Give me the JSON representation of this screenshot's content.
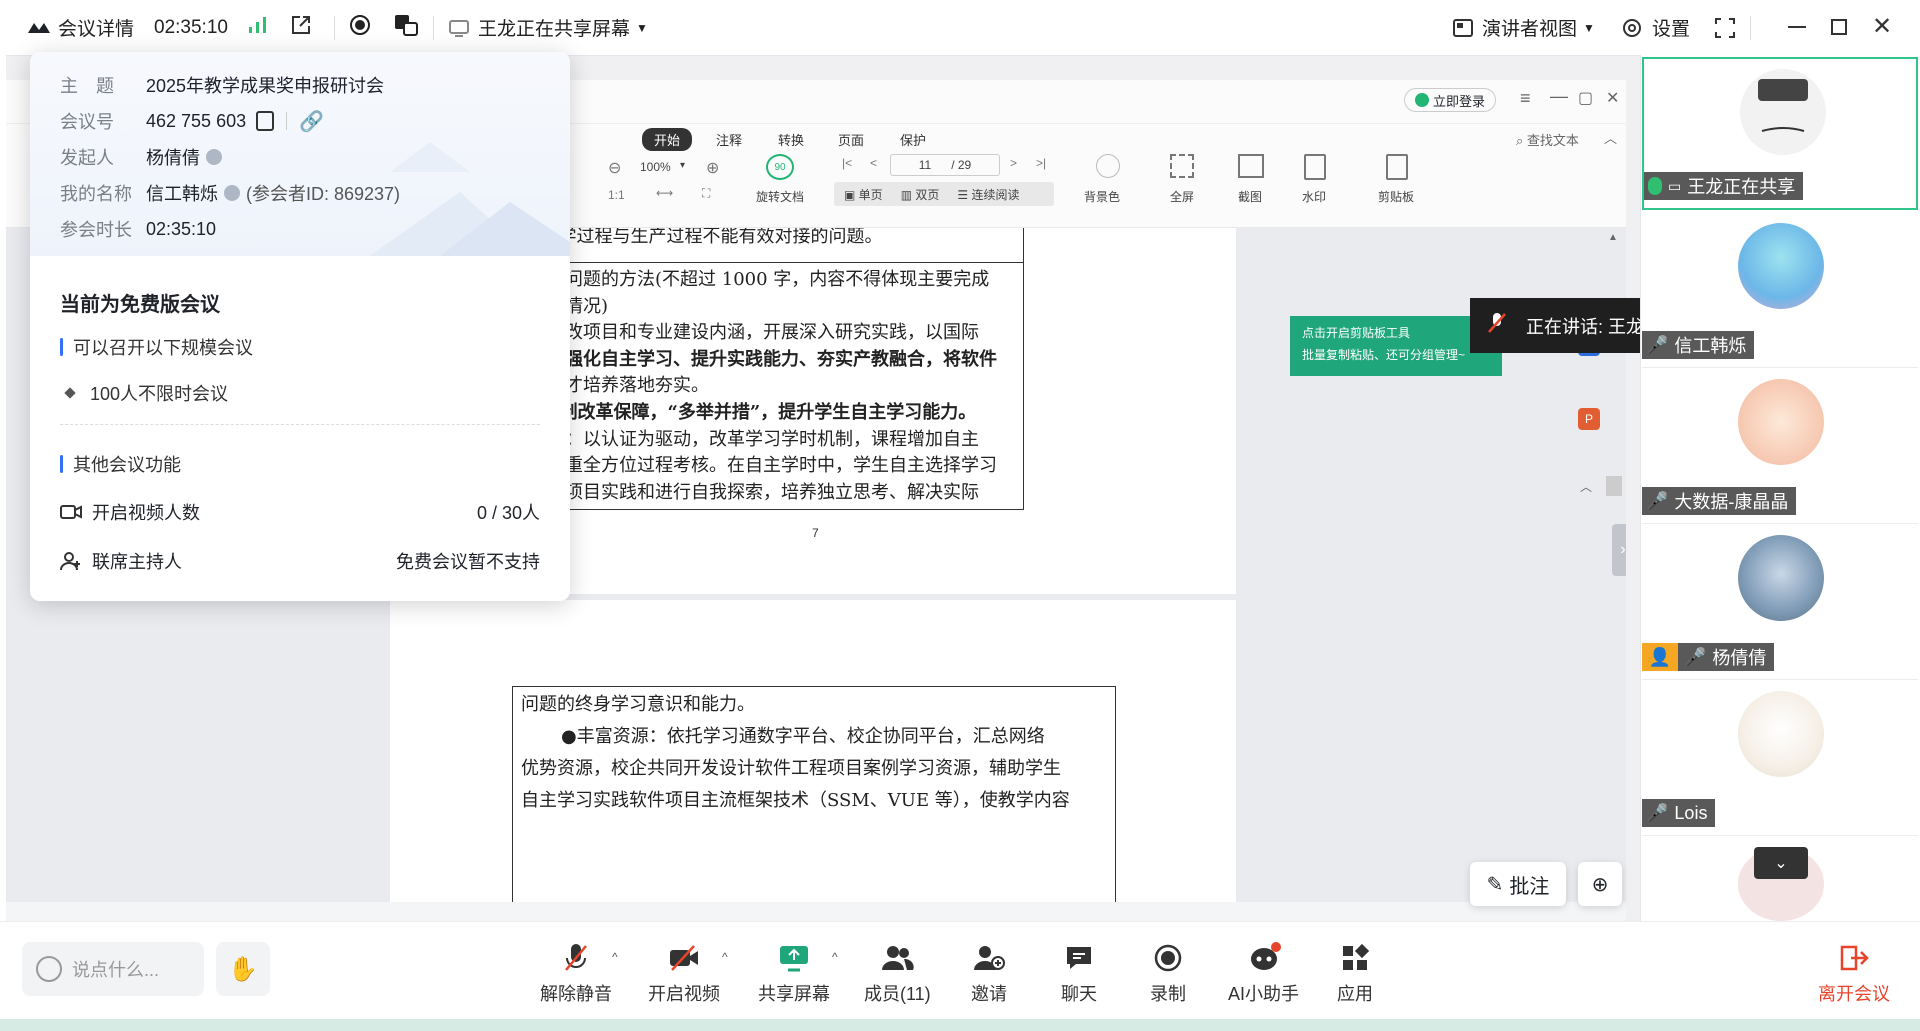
{
  "topbar": {
    "meeting_details": "会议详情",
    "elapsed": "02:35:10",
    "sharing_status": "王龙正在共享屏幕",
    "speaker_view": "演讲者视图",
    "settings": "设置"
  },
  "popup": {
    "subject_label": "主　题",
    "subject_value": "2025年教学成果奖申报研讨会",
    "meeting_id_label": "会议号",
    "meeting_id_value": "462 755 603",
    "host_label": "发起人",
    "host_value": "杨倩倩",
    "my_name_label": "我的名称",
    "my_name_value": "信工韩烁",
    "participant_id": "(参会者ID: 869237)",
    "duration_label": "参会时长",
    "duration_value": "02:35:10",
    "plan_title": "当前为免费版会议",
    "scale_title": "可以召开以下规模会议",
    "scale_item": "100人不限时会议",
    "other_title": "其他会议功能",
    "video_label": "开启视频人数",
    "video_value": "0 / 30人",
    "cohost_label": "联席主持人",
    "cohost_value": "免费会议暂不支持"
  },
  "pdf": {
    "login": "立即登录",
    "tabs": [
      "开始",
      "注释",
      "转换",
      "页面",
      "保护"
    ],
    "search": "查找文本",
    "zoom": "100%",
    "page_current": "11",
    "page_total": "/ 29",
    "tools": {
      "rotate": "旋转文档",
      "single": "单页",
      "double": "双页",
      "continuous": "连续阅读",
      "bg": "背景色",
      "fullscreen": "全屏",
      "screenshot": "截图",
      "watermark": "水印",
      "clipboard": "剪贴板"
    },
    "tip_line1": "点击开启剪贴板工具",
    "tip_line2": "批量复制粘贴、还可分组管理~",
    "page_number": "7",
    "page1_lines": [
      "（3）教学过程与生产过程不能有效对接的问题。",
      "解决教学问题的方法(不超过 1000 字，内容不得体现主要完成",
      "完成单位情况)",
      "果依托教改项目和专业建设内涵，开展深入研究实践，以国际",
      "为引领，强化自主学习、提升实践能力、夯实产教融合，将软件",
      "应用型人才培养落地夯实。",
      "（1）机制改革保障，“多举并措”，提升学生自主学习能力。",
      "改革机制：以认证为驱动，改革学习学时机制，课程增加自主",
      "学时，注重全方位过程考核。在自主学时中，学生自主选择学习",
      "参与软件项目实践和进行自我探索，培养独立思考、解决实际"
    ],
    "page2_lines": [
      "问题的终身学习意识和能力。",
      "●丰富资源：依托学习通数字平台、校企协同平台，汇总网络",
      "优势资源，校企共同开发设计软件工程项目案例学习资源，辅助学生",
      "自主学习实践软件项目主流框架技术（SSM、VUE 等），使教学内容"
    ],
    "annotate": "批注"
  },
  "speaking": "正在讲话:  王龙;",
  "participants": [
    {
      "name": "王龙正在共享"
    },
    {
      "name": "信工韩烁"
    },
    {
      "name": "大数据-康晶晶"
    },
    {
      "name": "杨倩倩"
    },
    {
      "name": "Lois"
    }
  ],
  "bottombar": {
    "chat_placeholder": "说点什么...",
    "unmute": "解除静音",
    "video": "开启视频",
    "share": "共享屏幕",
    "members": "成员(11)",
    "invite": "邀请",
    "chat": "聊天",
    "record": "录制",
    "ai": "AI小助手",
    "apps": "应用",
    "leave": "离开会议"
  },
  "colors": {
    "accent": "#3370ff",
    "leave": "#e8442b",
    "share_green": "#1fa67a",
    "active_border": "#2fc48a"
  }
}
